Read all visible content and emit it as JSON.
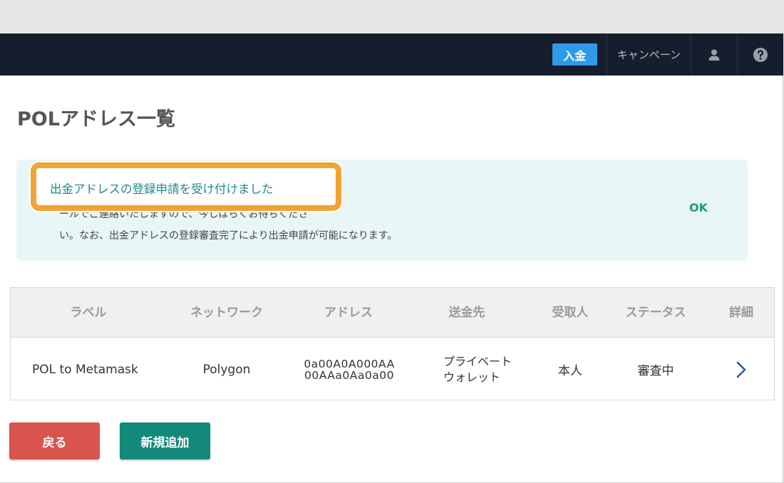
{
  "navbar": {
    "deposit_label": "入金",
    "campaign_label": "キャンペーン",
    "user_icon": "user-icon",
    "help_icon": "help-icon"
  },
  "page": {
    "title": "POLアドレス一覧"
  },
  "notice": {
    "title": "出金アドレスの登録申請を受け付けました",
    "line1": "ールでご連絡いたしますので、今しばらくお待ちくださ",
    "line2": "い。なお、出金アドレスの登録審査完了により出金申請が可能になります。",
    "ok_label": "OK"
  },
  "table": {
    "headers": [
      "ラベル",
      "ネットワーク",
      "アドレス",
      "送金先",
      "受取人",
      "ステータス",
      "詳細"
    ],
    "rows": [
      {
        "label": "POL to Metamask",
        "network": "Polygon",
        "address_line1": "0a00A0A000AA",
        "address_line2": "00AAa0Aa0a00",
        "destination_line1": "プライベート",
        "destination_line2": "ウォレット",
        "recipient": "本人",
        "status": "審査中"
      }
    ]
  },
  "buttons": {
    "back_label": "戻る",
    "add_label": "新規追加"
  },
  "colors": {
    "navbar_bg": "#161d2c",
    "deposit_blue": "#2e9be8",
    "notice_bg": "#e8f6f6",
    "notice_text": "#1d8c86",
    "highlight_orange": "#f2a332",
    "back_red": "#d9534f",
    "add_teal": "#13897a"
  }
}
